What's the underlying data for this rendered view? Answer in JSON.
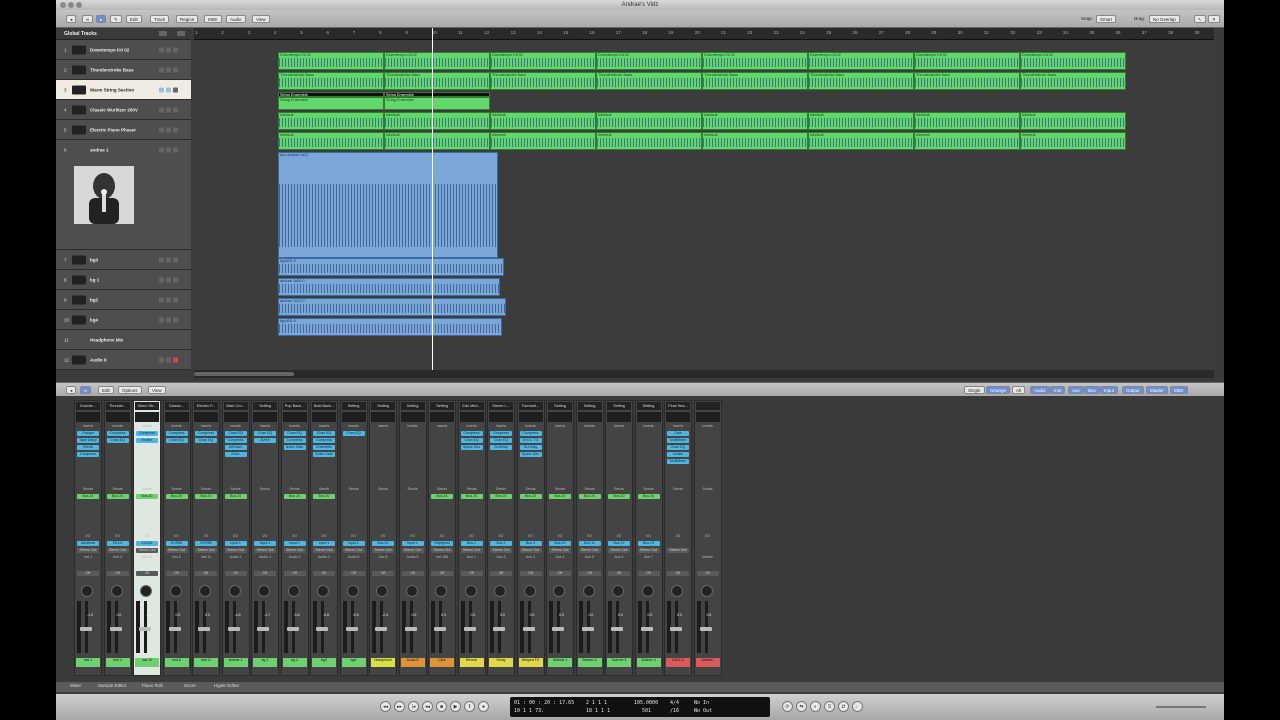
{
  "window": {
    "title": "Andrae's Vidz"
  },
  "toolbar": {
    "menus": [
      "Edit",
      "Track",
      "Region",
      "MIDI",
      "Audio",
      "View"
    ],
    "snap_label": "Snap:",
    "snap_value": "Smart",
    "drag_label": "Drag:",
    "drag_value": "No Overlap"
  },
  "global_tracks": "Global Tracks",
  "tracks": [
    {
      "num": "1",
      "name": "Downtempo Kit 02"
    },
    {
      "num": "2",
      "name": "Thunderstroke Bass"
    },
    {
      "num": "3",
      "name": "Warm String Section"
    },
    {
      "num": "4",
      "name": "Classic Wurlitzer 200V"
    },
    {
      "num": "5",
      "name": "Electric Piano Phaser"
    },
    {
      "num": "6",
      "name": "andrae 1"
    },
    {
      "num": "7",
      "name": "bg3"
    },
    {
      "num": "8",
      "name": "bg 1"
    },
    {
      "num": "9",
      "name": "bg2"
    },
    {
      "num": "10",
      "name": "bg4"
    },
    {
      "num": "11",
      "name": "Headphone Mix"
    },
    {
      "num": "12",
      "name": "Audio 8"
    }
  ],
  "ruler": [
    "1",
    "2",
    "3",
    "4",
    "5",
    "6",
    "7",
    "8",
    "9",
    "10",
    "11",
    "12",
    "13",
    "14",
    "15",
    "16",
    "17",
    "18",
    "19",
    "20",
    "21",
    "22",
    "23",
    "24",
    "25",
    "26",
    "27",
    "28",
    "29",
    "30",
    "31",
    "32",
    "33",
    "34",
    "35",
    "36",
    "37",
    "38",
    "39"
  ],
  "regions": {
    "drums": "Downtempo Kit 02",
    "bass": "Thunderstroke Bass",
    "strings": "String Ensemble",
    "default": "#default",
    "andrae": "anc andrae 1#17",
    "andrae2": "andrae 1#17.8",
    "bg3": "bg3#01.0",
    "bg1": "andrae 1#08.0",
    "bg2": "andrae 1#12.0",
    "bg4": "bg4#01.0"
  },
  "mixer_toolbar": {
    "menus": [
      "Edit",
      "Options",
      "View"
    ],
    "modes": [
      "Single",
      "Arrange",
      "All"
    ],
    "filters": [
      "Audio",
      "Inst",
      "Aux",
      "Bus",
      "Input",
      "Output",
      "Master",
      "MIDI"
    ]
  },
  "labels": {
    "eq": "EQ",
    "inserts": "Inserts",
    "sends": "Sends",
    "io": "I/O",
    "off": "Off"
  },
  "strips": [
    {
      "name": "Downte...",
      "ins": [
        "Flanger",
        "Tape Delay",
        "Pitch&",
        "Compress"
      ],
      "send": "Bus 24",
      "io": "Ultrabeat",
      "out": "Stereo Out",
      "grp": "Inst 1",
      "db": "-1.0",
      "bottom": "Inst 1"
    },
    {
      "name": "Thunder...",
      "ins": [
        "Compress",
        "Chan EQ"
      ],
      "send": "Bus 24",
      "io": "ES1/4",
      "out": "Stereo Out",
      "grp": "Inst 4",
      "db": "0.0",
      "bottom": "Inst 4"
    },
    {
      "name": "Warm Str...",
      "ins": [
        "Compress",
        "Exciter"
      ],
      "send": "Bus 20",
      "io": "EXS24",
      "out": "Stereo Out",
      "grp": "Inst 10",
      "db": "-1.7",
      "bottom": "Inst 10"
    },
    {
      "name": "Classic...",
      "ins": [
        "Compress",
        "Chan EQ"
      ],
      "send": "Bus 20",
      "io": "EVP88",
      "out": "Stereo Out",
      "grp": "Inst 6",
      "db": "0.0",
      "bottom": "Inst 6"
    },
    {
      "name": "Electric P...",
      "ins": [
        "Compress",
        "Chan EQ"
      ],
      "send": "Bus 20",
      "io": "EVP88",
      "out": "Stereo Out",
      "grp": "Inst 11",
      "db": "0.0",
      "bottom": "Inst 11"
    },
    {
      "name": "Male Cro...",
      "ins": [
        "Chan EQ",
        "Compress",
        "DeEsser",
        "Echo"
      ],
      "send": "Bus 24",
      "io": "Input 1",
      "out": "Stereo Out",
      "grp": "Audio 1",
      "db": "-4.6",
      "bottom": "andrae 1"
    },
    {
      "name": "Setting",
      "ins": [
        "Chan EQ",
        "AVerb"
      ],
      "send": "",
      "io": "Input 1",
      "out": "Stereo Out",
      "grp": "Audio 4",
      "db": "-1.7",
      "bottom": "bg 1"
    },
    {
      "name": "Pop Back...",
      "ins": [
        "Chan EQ",
        "Compress",
        "Noise Gate"
      ],
      "send": "Bus 24",
      "io": "Input 1",
      "out": "Stereo Out",
      "grp": "Audio 2",
      "db": "-9.6",
      "bottom": "bg 1"
    },
    {
      "name": "Bold Back...",
      "ins": [
        "Chan EQ",
        "Compress",
        "Ensemble",
        "Noise Gate"
      ],
      "send": "Bus 20",
      "io": "Input 1",
      "out": "Stereo Out",
      "grp": "Audio 3",
      "db": "-9.6",
      "bottom": "bg2"
    },
    {
      "name": "Setting",
      "ins": [
        "Chan EQ"
      ],
      "send": "",
      "io": "Input 1",
      "out": "Stereo Out",
      "grp": "Audio 5",
      "db": "-9.6",
      "bottom": "bg4"
    },
    {
      "name": "Setting",
      "ins": [],
      "send": "",
      "io": "Bus 20",
      "out": "Stereo Out",
      "grp": "Aux 8",
      "db": "-2.4",
      "bottom": "Headphone"
    },
    {
      "name": "Setting",
      "ins": [],
      "send": "",
      "io": "Input 1",
      "out": "Stereo Out",
      "grp": "Audio 8",
      "db": "0.0",
      "bottom": "Audio 8"
    },
    {
      "name": "Setting",
      "ins": [],
      "send": "Bus 24",
      "io": "Klopfgeist",
      "out": "Stereo Out",
      "grp": "Inst 256",
      "db": "0.0",
      "bottom": "Click"
    },
    {
      "name": "Edu Med...",
      "ins": [
        "Compress",
        "Chan EQ",
        "Space Des"
      ],
      "send": "Bus 20",
      "io": "Bus 1",
      "out": "Stereo Out",
      "grp": "Aux 1",
      "db": "0.0",
      "bottom": "Reverb"
    },
    {
      "name": "Stereo L...",
      "ins": [
        "Compress",
        "Chan EQ",
        "St-Delay"
      ],
      "send": "Bus 20",
      "io": "Bus 2",
      "out": "Stereo Out",
      "grp": "Aux 2",
      "db": "0.0",
      "bottom": "Delay"
    },
    {
      "name": "Formant...",
      "ins": [
        "Compress",
        "EVOC TG",
        "St-Delay",
        "Space Des"
      ],
      "send": "Bus 20",
      "io": "Bus 3",
      "out": "Stereo Out",
      "grp": "Aux 3",
      "db": "0.0",
      "bottom": "Warped FX"
    },
    {
      "name": "Setting",
      "ins": [],
      "send": "Bus 20",
      "io": "Bus 10",
      "out": "Stereo Out",
      "grp": "Aux 4",
      "db": "0.0",
      "bottom": "Submix 1"
    },
    {
      "name": "Setting",
      "ins": [],
      "send": "Bus 20",
      "io": "Bus 11",
      "out": "Stereo Out",
      "grp": "Aux 5",
      "db": "0.0",
      "bottom": "Submix 2"
    },
    {
      "name": "Setting",
      "ins": [],
      "send": "Bus 20",
      "io": "Bus 12",
      "out": "Stereo Out",
      "grp": "Aux 6",
      "db": "0.0",
      "bottom": "Submix 3"
    },
    {
      "name": "Setting",
      "ins": [],
      "send": "Bus 24",
      "io": "Bus 13",
      "out": "Stereo Out",
      "grp": "Aux 7",
      "db": "0.0",
      "bottom": "Submix 4"
    },
    {
      "name": "Final Hea...",
      "ins": [
        "Gain",
        "MultiMeter",
        "Chan EQ",
        "Limiter",
        "MultiMeter"
      ],
      "send": "",
      "io": "",
      "out": "Stereo Out",
      "grp": "",
      "db": "0.0",
      "bottom": "Out 1-2"
    },
    {
      "name": "",
      "ins": [],
      "send": "",
      "io": "",
      "out": "",
      "grp": "Master",
      "db": "0.0",
      "bottom": "Master"
    }
  ],
  "mixer_tabs": [
    "Mixer",
    "Sample Editor",
    "Piano Roll",
    "Score",
    "Hyper Editor"
  ],
  "transport": {
    "time": "01 : 00 : 20 : 17.65",
    "bars": "10   1   1   73.",
    "pos1": "2   1   1   1",
    "pos2": "18   1   1   1",
    "tempo": "105.0000",
    "tempo2": "501",
    "sig": "4/4",
    "sig2": "/16",
    "in": "No In",
    "out": "No Out"
  },
  "colors": {
    "midi_region": "#63d76d",
    "audio_region": "#7aa6d8",
    "playhead": "#ffffff"
  }
}
